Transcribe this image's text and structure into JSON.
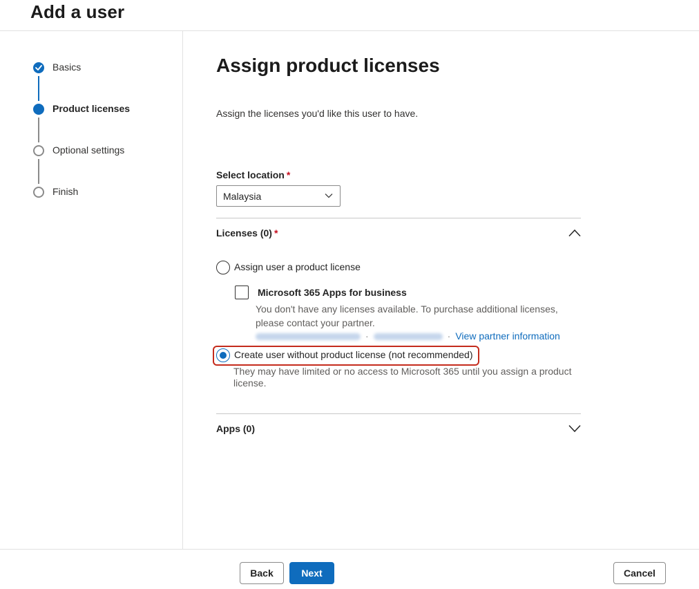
{
  "header": {
    "title": "Add a user"
  },
  "steps": [
    {
      "label": "Basics",
      "state": "complete"
    },
    {
      "label": "Product licenses",
      "state": "current"
    },
    {
      "label": "Optional settings",
      "state": "pending"
    },
    {
      "label": "Finish",
      "state": "pending"
    }
  ],
  "main": {
    "title": "Assign product licenses",
    "description": "Assign the licenses you'd like this user to have.",
    "location": {
      "label": "Select location",
      "required_mark": "*",
      "value": "Malaysia"
    },
    "licenses": {
      "title": "Licenses (0)",
      "required_mark": "*",
      "expanded": true,
      "option_assign": "Assign user a product license",
      "product": {
        "name": "Microsoft 365 Apps for business",
        "help": "You don't have any licenses available. To purchase additional licenses, please contact your partner.",
        "separator": "·",
        "partner_link": "View partner information"
      },
      "option_none": "Create user without product license (not recommended)",
      "option_none_help": "They may have limited or no access to Microsoft 365 until you assign a product license.",
      "selected": "option_none"
    },
    "apps": {
      "title": "Apps (0)",
      "expanded": false
    }
  },
  "footer": {
    "back_label": "Back",
    "next_label": "Next",
    "cancel_label": "Cancel"
  },
  "colors": {
    "accent": "#0f6cbd",
    "highlight": "#c42b1c",
    "required": "#c50f1f"
  },
  "icons": {
    "step_complete": "checkmark-icon",
    "location_dropdown": "chevron-down-icon",
    "licenses_toggle": "chevron-up-icon",
    "apps_toggle": "chevron-down-icon"
  }
}
